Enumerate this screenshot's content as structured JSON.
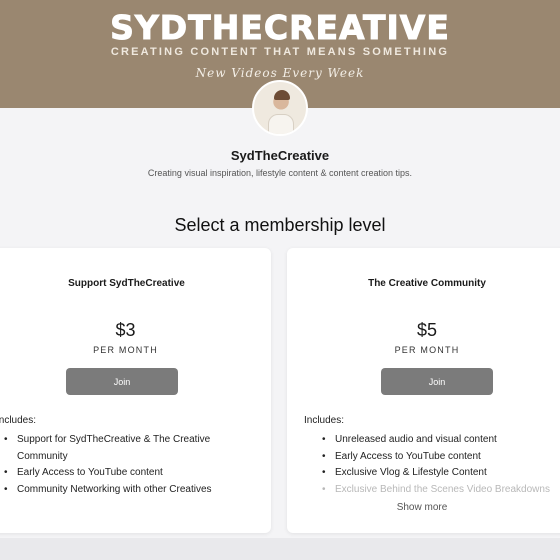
{
  "banner": {
    "title": "SYDTHECREATIVE",
    "subtitle": "CREATING CONTENT THAT MEANS SOMETHING",
    "script": "New Videos Every Week"
  },
  "creator": {
    "name": "SydTheCreative",
    "description": "Creating visual inspiration, lifestyle content & content creation tips."
  },
  "section_title": "Select a membership level",
  "tiers": [
    {
      "name": "Support SydTheCreative",
      "price": "$3",
      "period": "PER MONTH",
      "join_label": "Join",
      "includes_label": "Includes:",
      "benefits": [
        "Support for SydTheCreative & The Creative Community",
        "Early Access to YouTube content",
        "Community Networking with other Creatives"
      ]
    },
    {
      "name": "The Creative Community",
      "price": "$5",
      "period": "PER MONTH",
      "join_label": "Join",
      "includes_label": "Includes:",
      "benefits": [
        "Unreleased audio and visual content",
        "Early Access to YouTube content",
        "Exclusive Vlog & Lifestyle Content",
        "Exclusive Behind the Scenes Video Breakdowns"
      ],
      "show_more": "Show more"
    }
  ],
  "colors": {
    "banner": "#9a8770",
    "button": "#7b7b7b",
    "page_bg": "#f4f4f6"
  }
}
